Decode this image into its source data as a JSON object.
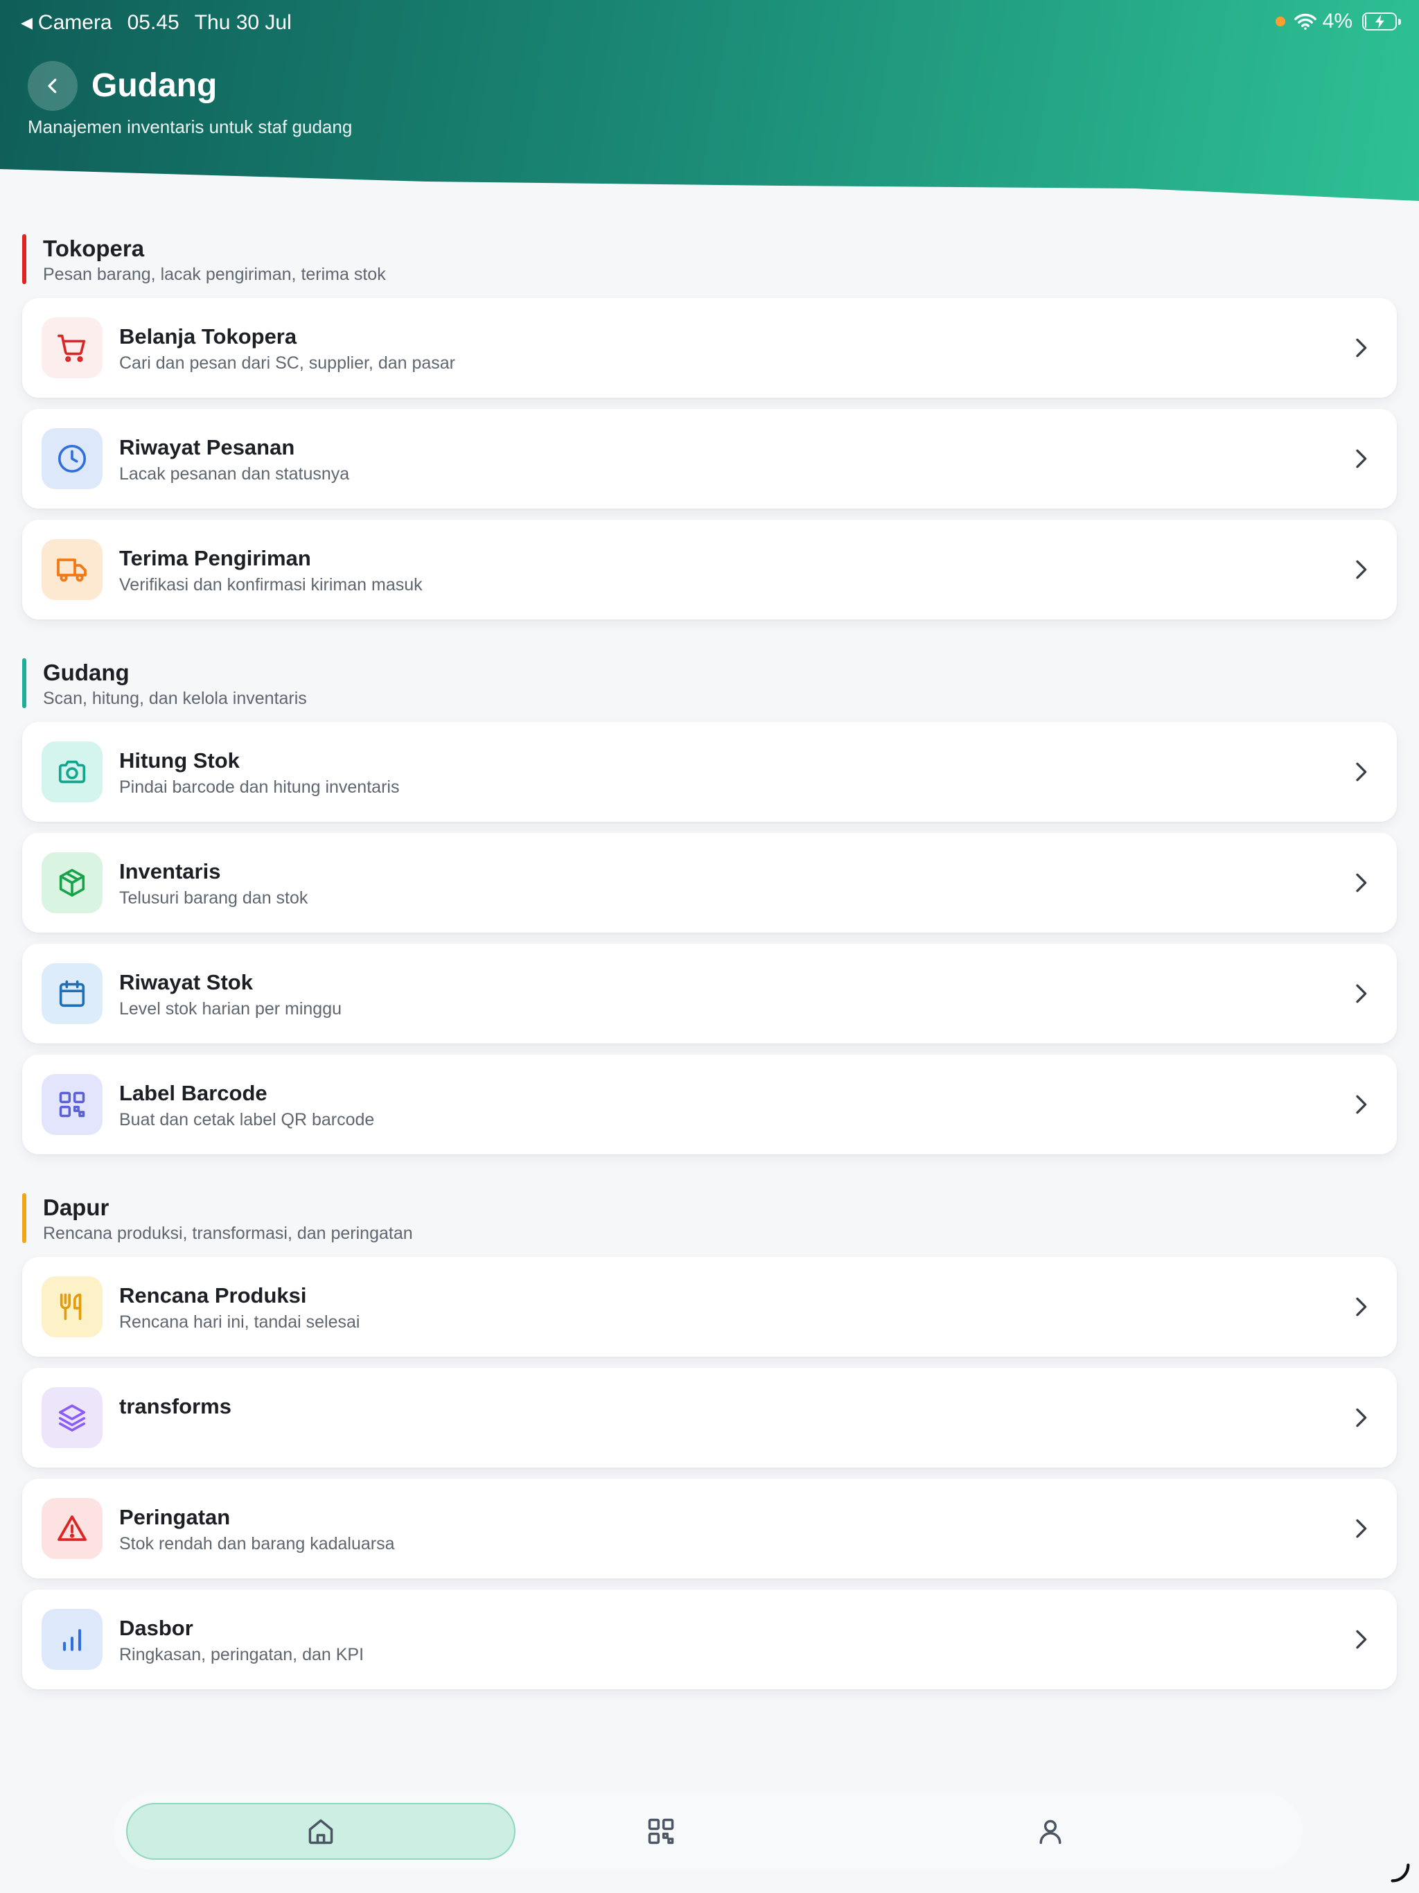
{
  "status_bar": {
    "back_app": "Camera",
    "time": "05.45",
    "date": "Thu 30 Jul",
    "battery": "4%",
    "battery_level": 0.04
  },
  "header": {
    "title": "Gudang",
    "subtitle": "Manajemen inventaris untuk staf gudang"
  },
  "sections": [
    {
      "title": "Tokopera",
      "description": "Pesan barang, lacak pengiriman, terima stok",
      "accent": "#e02424",
      "items": [
        {
          "title": "Belanja Tokopera",
          "description": "Cari dan pesan dari SC, supplier, dan pasar",
          "icon": "cart-icon",
          "bg": "#fdeeee",
          "color": "#dc2626"
        },
        {
          "title": "Riwayat Pesanan",
          "description": "Lacak pesanan dan statusnya",
          "icon": "clock-icon",
          "bg": "#dde9fb",
          "color": "#2f6fdc"
        },
        {
          "title": "Terima Pengiriman",
          "description": "Verifikasi dan konfirmasi kiriman masuk",
          "icon": "truck-icon",
          "bg": "#fde8d2",
          "color": "#f07a18"
        }
      ]
    },
    {
      "title": "Gudang",
      "description": "Scan, hitung, dan kelola inventaris",
      "accent": "#1fae9a",
      "items": [
        {
          "title": "Hitung Stok",
          "description": "Pindai barcode dan hitung inventaris",
          "icon": "camera-icon",
          "bg": "#d4f5ee",
          "color": "#14a58e"
        },
        {
          "title": "Inventaris",
          "description": "Telusuri barang dan stok",
          "icon": "box-icon",
          "bg": "#d9f5e2",
          "color": "#17a34a"
        },
        {
          "title": "Riwayat Stok",
          "description": "Level stok harian per minggu",
          "icon": "calendar-icon",
          "bg": "#dcecfb",
          "color": "#1f6fb8"
        },
        {
          "title": "Label Barcode",
          "description": "Buat dan cetak label QR barcode",
          "icon": "qr-code-icon",
          "bg": "#e2e5fb",
          "color": "#5a5fd6"
        }
      ]
    },
    {
      "title": "Dapur",
      "description": "Rencana produksi, transformasi, dan peringatan",
      "accent": "#f2a516",
      "items": [
        {
          "title": "Rencana Produksi",
          "description": "Rencana hari ini, tandai selesai",
          "icon": "utensils-icon",
          "bg": "#fdf1c8",
          "color": "#e49b0c"
        },
        {
          "title": "transforms",
          "description": "",
          "icon": "layers-icon",
          "bg": "#ede6fb",
          "color": "#8b5cf6"
        },
        {
          "title": "Peringatan",
          "description": "Stok rendah dan barang kadaluarsa",
          "icon": "alert-triangle-icon",
          "bg": "#fde2e2",
          "color": "#dc2626"
        },
        {
          "title": "Dasbor",
          "description": "Ringkasan, peringatan, dan KPI",
          "icon": "bar-chart-icon",
          "bg": "#dde9fb",
          "color": "#2f6fdc"
        }
      ]
    }
  ],
  "bottom_nav": [
    {
      "name": "home",
      "icon": "home-icon",
      "active": true
    },
    {
      "name": "scan",
      "icon": "qr-code-icon",
      "active": false
    },
    {
      "name": "profile",
      "icon": "user-icon",
      "active": false
    }
  ]
}
